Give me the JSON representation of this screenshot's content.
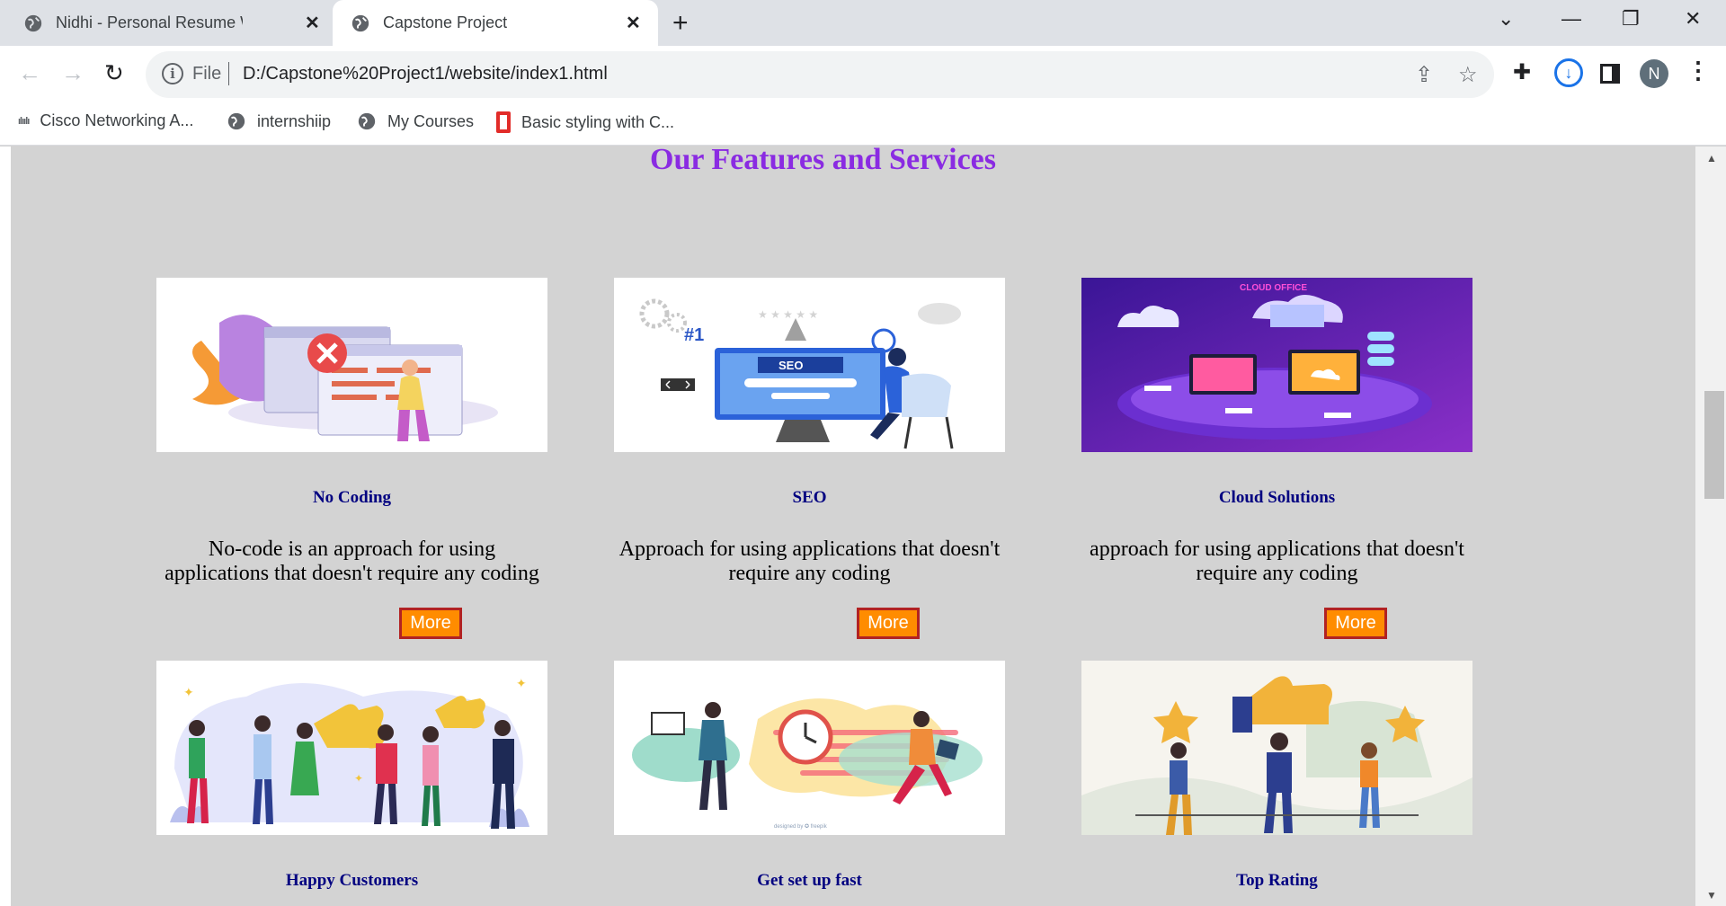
{
  "browser": {
    "tabs": [
      {
        "title": "Nidhi - Personal Resume Website",
        "close": "✕"
      },
      {
        "title": "Capstone Project",
        "close": "✕"
      }
    ],
    "new_tab": "+",
    "window_controls": {
      "dropdown": "⌄",
      "minimize": "—",
      "restore": "❐",
      "close": "✕"
    },
    "nav": {
      "back": "←",
      "forward": "→",
      "reload": "↻"
    },
    "omnibox": {
      "info": "i",
      "scheme": "File",
      "url": "D:/Capstone%20Project1/website/index1.html"
    },
    "share": "⇪",
    "star": "☆",
    "extensions": "✚",
    "download": "↓",
    "profile_initial": "N",
    "menu": "⋮",
    "bookmarks": [
      {
        "label": "Cisco Networking A...",
        "icon": "cisco-icon"
      },
      {
        "label": "internshiip",
        "icon": "globe-icon"
      },
      {
        "label": "My Courses",
        "icon": "globe-icon"
      },
      {
        "label": "Basic styling with C...",
        "icon": "office-icon"
      }
    ],
    "cisco_glyph": "ılıılı"
  },
  "page": {
    "section_title": "Our Features and Services",
    "more_label": "More",
    "cards": [
      {
        "title": "No Coding",
        "description": "No-code is an approach for using applications that doesn't require any coding",
        "image": "no-coding-illustration"
      },
      {
        "title": "SEO",
        "description": "Approach for using applications that doesn't require any coding",
        "image": "seo-illustration",
        "image_text": "SEO",
        "image_rank": "#1"
      },
      {
        "title": "Cloud Solutions",
        "description": "approach for using applications that doesn't require any coding",
        "image": "cloud-office-illustration",
        "image_text": "CLOUD OFFICE"
      },
      {
        "title": "Happy Customers",
        "image": "happy-customers-illustration"
      },
      {
        "title": "Get set up fast",
        "image": "get-set-up-fast-illustration"
      },
      {
        "title": "Top Rating",
        "image": "top-rating-illustration"
      }
    ]
  },
  "colors": {
    "page_bg": "#d3d3d3",
    "title": "#8a2be2",
    "card_title": "#000080",
    "button_bg": "#ff8c00",
    "button_border": "#b22222"
  }
}
